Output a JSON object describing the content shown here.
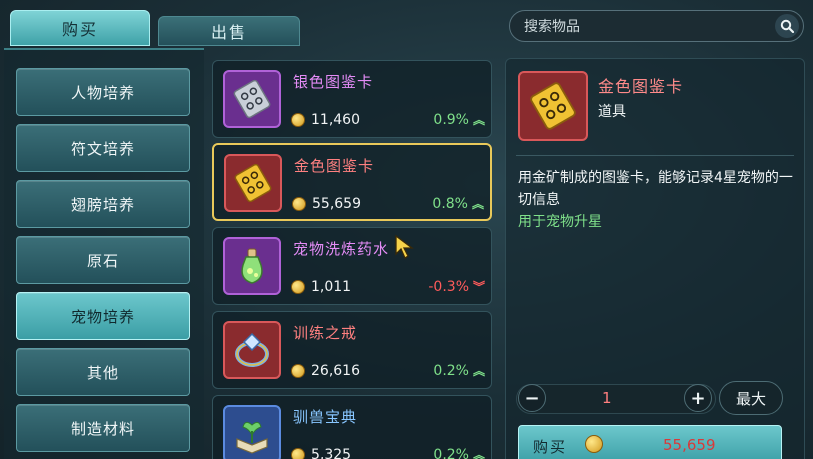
{
  "tabs": {
    "buy": "购买",
    "sell": "出售"
  },
  "search": {
    "placeholder": "搜索物品"
  },
  "categories": [
    {
      "label": "人物培养",
      "active": false
    },
    {
      "label": "符文培养",
      "active": false
    },
    {
      "label": "翅膀培养",
      "active": false
    },
    {
      "label": "原石",
      "active": false
    },
    {
      "label": "宠物培养",
      "active": true
    },
    {
      "label": "其他",
      "active": false
    },
    {
      "label": "制造材料",
      "active": false
    }
  ],
  "items": [
    {
      "name": "银色图鉴卡",
      "price": "11,460",
      "change": "0.9%",
      "trend": "up",
      "frame": "purple",
      "icon": "silver-card-icon"
    },
    {
      "name": "金色图鉴卡",
      "price": "55,659",
      "change": "0.8%",
      "trend": "up",
      "frame": "red",
      "icon": "gold-card-icon"
    },
    {
      "name": "宠物洗炼药水",
      "price": "1,011",
      "change": "-0.3%",
      "trend": "down",
      "frame": "purple",
      "icon": "potion-icon"
    },
    {
      "name": "训练之戒",
      "price": "26,616",
      "change": "0.2%",
      "trend": "up",
      "frame": "red",
      "icon": "ring-icon"
    },
    {
      "name": "驯兽宝典",
      "price": "5,325",
      "change": "0.2%",
      "trend": "up",
      "frame": "blue",
      "icon": "book-icon"
    }
  ],
  "detail": {
    "name": "金色图鉴卡",
    "type": "道具",
    "description": "用金矿制成的图鉴卡，能够记录4星宠物的一切信息",
    "use": "用于宠物升星",
    "quantity": "1",
    "max_label": "最大",
    "buy_label": "购买",
    "total_price": "55,659"
  },
  "colors": {
    "accent": "#4fb3b8",
    "gold": "#f0d65a",
    "up": "#7fe08a",
    "down": "#ff5b5b"
  }
}
